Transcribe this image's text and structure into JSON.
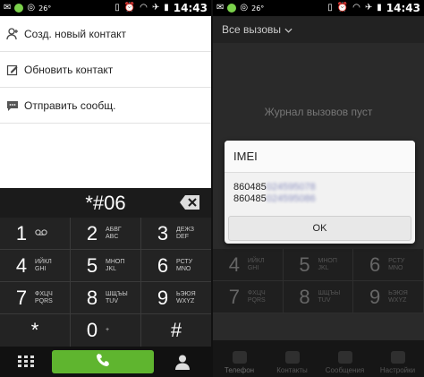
{
  "status_bar": {
    "temperature": "26°",
    "time": "14:43"
  },
  "left": {
    "menu": [
      {
        "label": "Созд. новый контакт",
        "icon": "person-add-icon"
      },
      {
        "label": "Обновить контакт",
        "icon": "edit-icon"
      },
      {
        "label": "Отправить сообщ.",
        "icon": "message-icon"
      }
    ],
    "dial_number": "*#06",
    "keypad": [
      [
        {
          "digit": "1",
          "letters": "ᴏ_ᴏ"
        },
        {
          "digit": "2",
          "letters": "АБВГ\nABC"
        },
        {
          "digit": "3",
          "letters": "ДЕЖЗ\nDEF"
        }
      ],
      [
        {
          "digit": "4",
          "letters": "ИЙКЛ\nGHI"
        },
        {
          "digit": "5",
          "letters": "МНОП\nJKL"
        },
        {
          "digit": "6",
          "letters": "РСТУ\nMNO"
        }
      ],
      [
        {
          "digit": "7",
          "letters": "ФХЦЧ\nPQRS"
        },
        {
          "digit": "8",
          "letters": "ШЩЪЫ\nTUV"
        },
        {
          "digit": "9",
          "letters": "ЬЭЮЯ\nWXYZ"
        }
      ],
      [
        {
          "digit": "*",
          "letters": ""
        },
        {
          "digit": "0",
          "letters": "+"
        },
        {
          "digit": "#",
          "letters": ""
        }
      ]
    ],
    "accent_call_color": "#5fb52f"
  },
  "right": {
    "header": "Все вызовы",
    "empty_log": "Журнал вызовов пуст",
    "dialog": {
      "title": "IMEI",
      "imei1_visible": "860485",
      "imei1_hidden": "024595078",
      "imei2_visible": "860485",
      "imei2_hidden": "024595086",
      "ok_label": "OK"
    },
    "keypad_visible": [
      [
        {
          "digit": "4",
          "letters": "ИЙКЛ\nGHI"
        },
        {
          "digit": "5",
          "letters": "МНОП\nJKL"
        },
        {
          "digit": "6",
          "letters": "РСТУ\nMNO"
        }
      ],
      [
        {
          "digit": "7",
          "letters": "ФХЦЧ\nPQRS"
        },
        {
          "digit": "8",
          "letters": "ШЩЪЫ\nTUV"
        },
        {
          "digit": "9",
          "letters": "ЬЭЮЯ\nWXYZ"
        }
      ]
    ],
    "nav": [
      {
        "label": "Телефон",
        "icon": "phone-icon"
      },
      {
        "label": "Контакты",
        "icon": "contacts-icon"
      },
      {
        "label": "Сообщения",
        "icon": "messages-icon"
      },
      {
        "label": "Настройки",
        "icon": "settings-icon"
      }
    ]
  }
}
